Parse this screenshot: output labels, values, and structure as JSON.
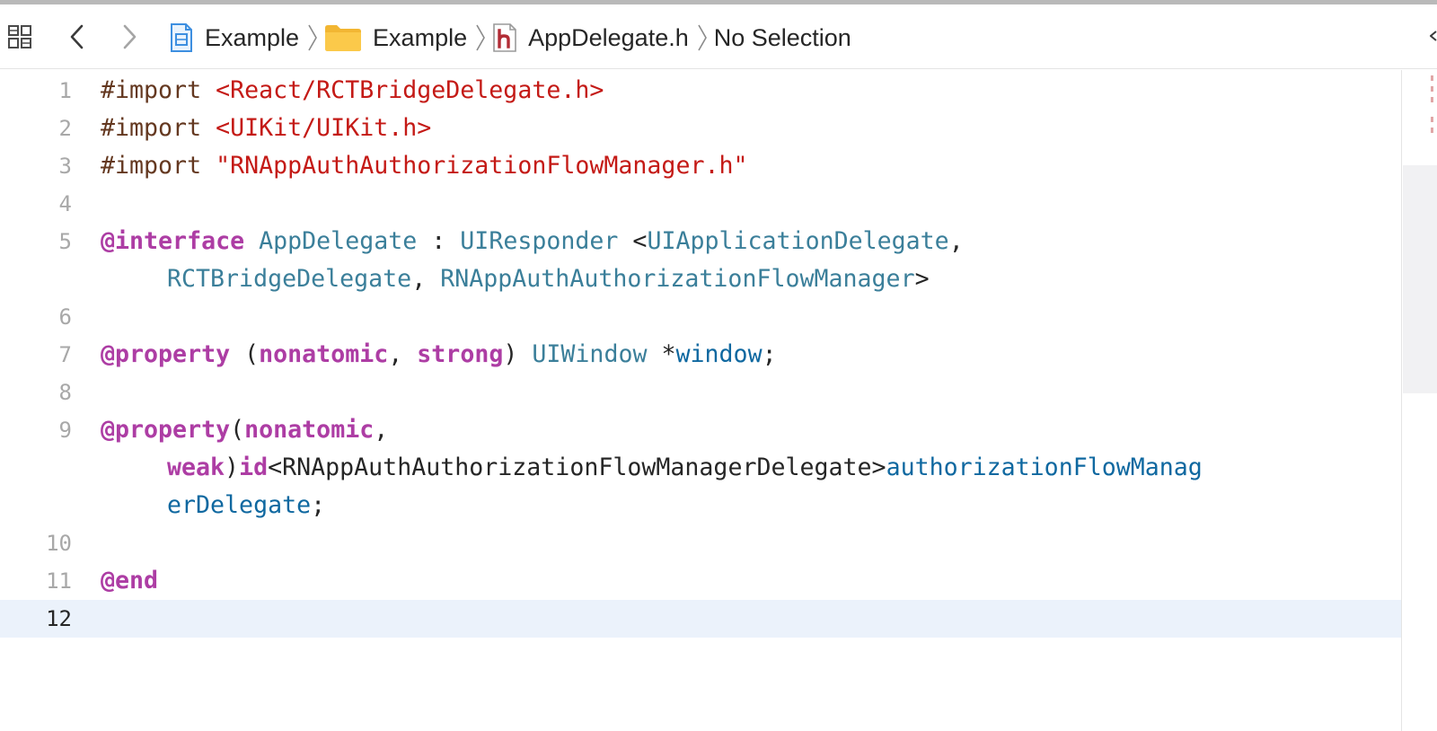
{
  "jumpbar": {
    "icons": {
      "grid": "related-items-grid-icon",
      "back": "chevron-left-icon",
      "forward": "chevron-right-icon",
      "project": "xcode-project-icon",
      "folder": "folder-icon",
      "header_file": "header-file-icon",
      "separator": "chevron-right-icon"
    },
    "breadcrumbs": [
      {
        "label": "Example",
        "kind": "project"
      },
      {
        "label": "Example",
        "kind": "folder"
      },
      {
        "label": "AppDelegate.h",
        "kind": "header-file"
      },
      {
        "label": "No Selection",
        "kind": "symbol"
      }
    ]
  },
  "editor": {
    "current_line": 12,
    "line_numbers": [
      "1",
      "2",
      "3",
      "4",
      "5",
      "6",
      "7",
      "8",
      "9",
      "10",
      "11",
      "12"
    ],
    "lines": [
      [
        [
          "#import ",
          "c-pre"
        ],
        [
          "<React/RCTBridgeDelegate.h>",
          "c-str"
        ]
      ],
      [
        [
          "#import ",
          "c-pre"
        ],
        [
          "<UIKit/UIKit.h>",
          "c-str"
        ]
      ],
      [
        [
          "#import ",
          "c-pre"
        ],
        [
          "\"RNAppAuthAuthorizationFlowManager.h\"",
          "c-str"
        ]
      ],
      [],
      [
        [
          "@interface",
          "c-kw"
        ],
        [
          " ",
          "c-plain"
        ],
        [
          "AppDelegate",
          "c-type"
        ],
        [
          " : ",
          "c-plain"
        ],
        [
          "UIResponder",
          "c-type"
        ],
        [
          " <",
          "c-plain"
        ],
        [
          "UIApplicationDelegate",
          "c-type"
        ],
        [
          ",",
          "c-plain"
        ]
      ],
      [
        [
          "RCTBridgeDelegate",
          "c-type"
        ],
        [
          ", ",
          "c-plain"
        ],
        [
          "RNAppAuthAuthorizationFlowManager",
          "c-type"
        ],
        [
          ">",
          "c-plain"
        ]
      ],
      [],
      [
        [
          "@property",
          "c-kw"
        ],
        [
          " (",
          "c-plain"
        ],
        [
          "nonatomic",
          "c-kw"
        ],
        [
          ", ",
          "c-plain"
        ],
        [
          "strong",
          "c-kw"
        ],
        [
          ") ",
          "c-plain"
        ],
        [
          "UIWindow",
          "c-type"
        ],
        [
          " *",
          "c-plain"
        ],
        [
          "window",
          "c-var"
        ],
        [
          ";",
          "c-plain"
        ]
      ],
      [],
      [
        [
          "@property",
          "c-kw"
        ],
        [
          "(",
          "c-plain"
        ],
        [
          "nonatomic",
          "c-kw"
        ],
        [
          ",",
          "c-plain"
        ]
      ],
      [
        [
          "weak",
          "c-kw"
        ],
        [
          ")",
          "c-plain"
        ],
        [
          "id",
          "c-kw"
        ],
        [
          "<RNAppAuthAuthorizationFlowManagerDelegate>",
          "c-plain"
        ],
        [
          "authorizationFlowManag",
          "c-var"
        ]
      ],
      [
        [
          "erDelegate",
          "c-var"
        ],
        [
          ";",
          "c-plain"
        ]
      ],
      [],
      [
        [
          "@end",
          "c-kw"
        ]
      ],
      []
    ]
  }
}
